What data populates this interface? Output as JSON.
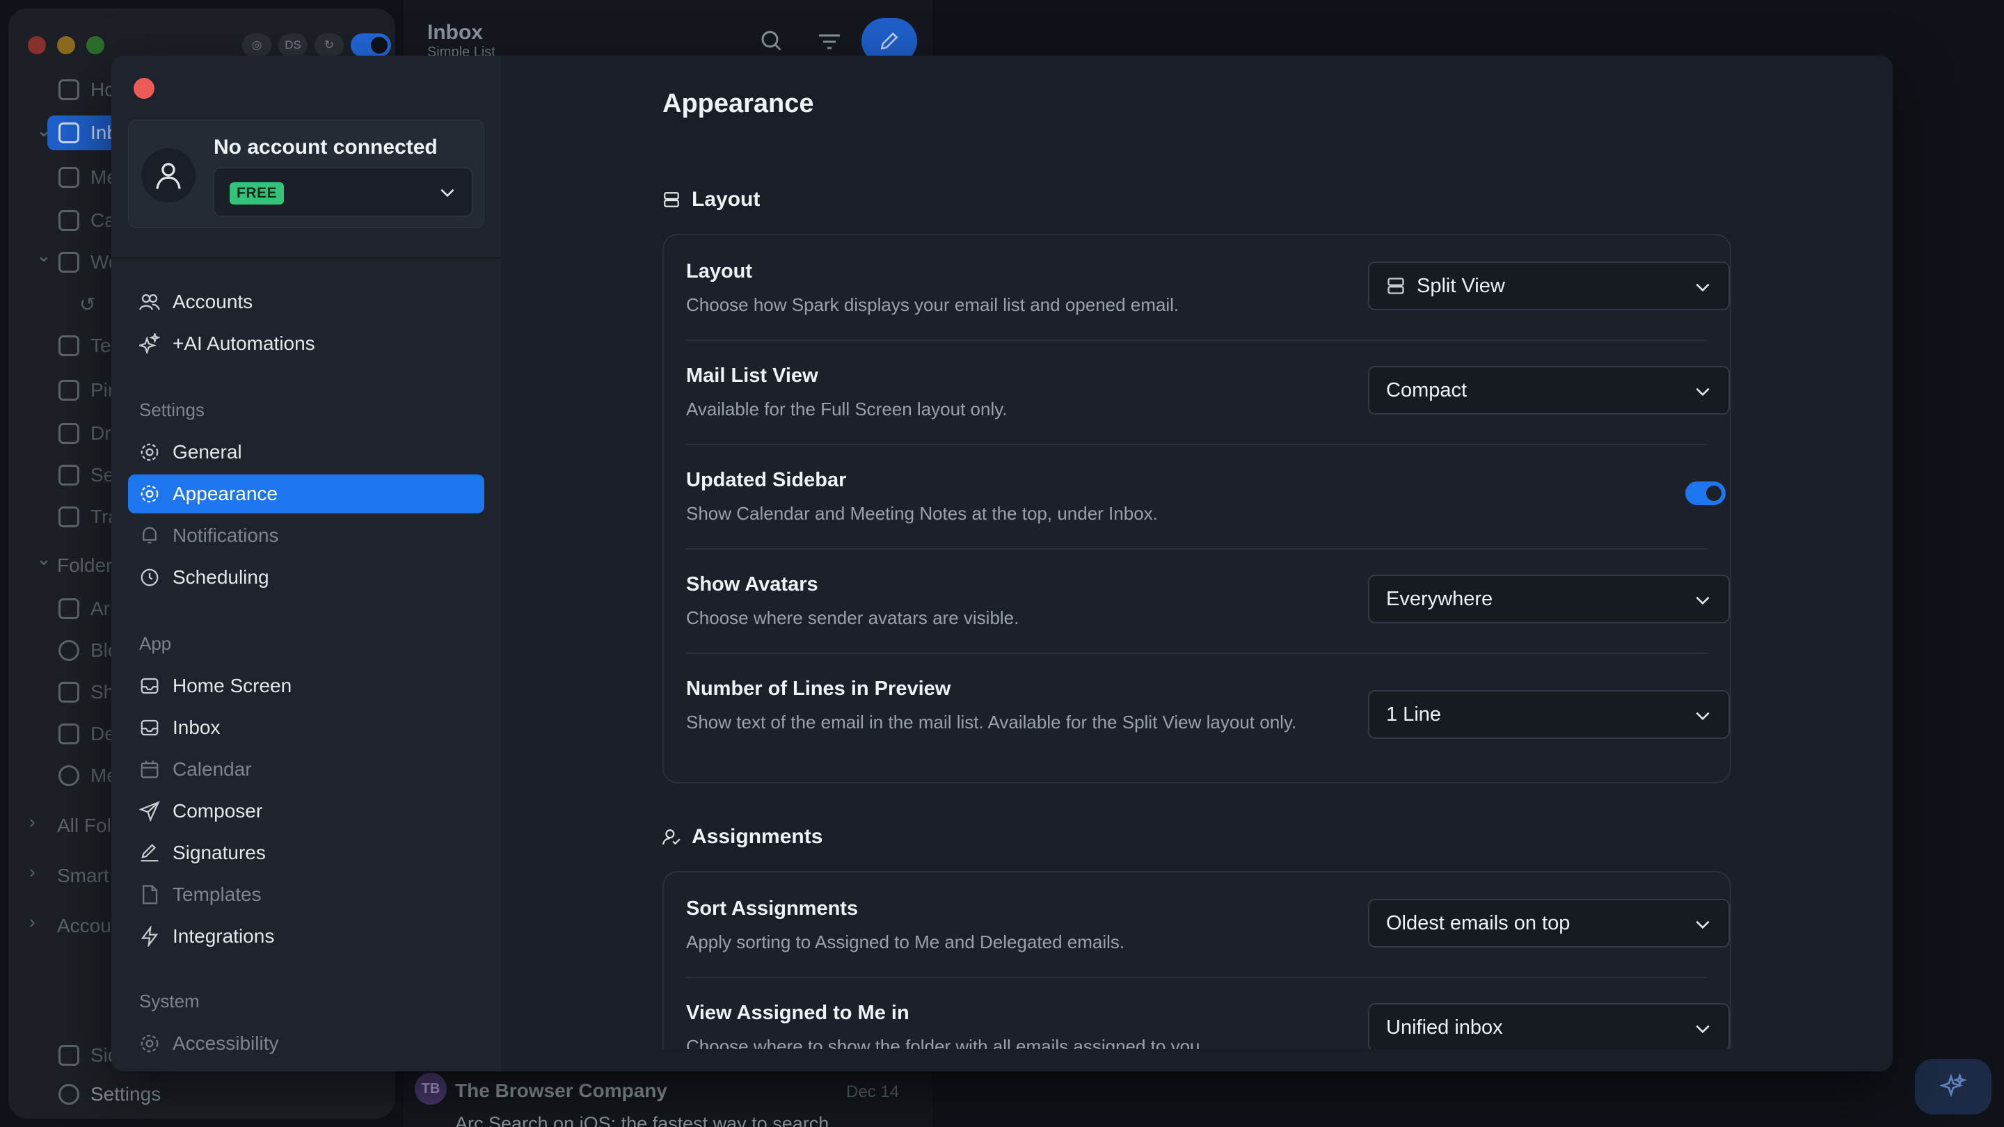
{
  "background_window": {
    "sidebar_icons": [
      "globe-icon",
      "DS",
      "sync-icon"
    ],
    "sidebar_items": [
      "Ho",
      "Inb",
      "Me",
      "Ca",
      "Wo",
      "Te",
      "Pin",
      "Dr",
      "Se",
      "Tra",
      "Folder",
      "Ar",
      "Blo",
      "Sh",
      "De",
      "Me",
      "All Fol",
      "Smart",
      "Accou",
      "Sid",
      "Settings"
    ],
    "main_title": "Inbox",
    "main_subtitle": "Simple List",
    "mail_preview": {
      "avatar": "TB",
      "from": "The Browser Company",
      "date": "Dec 14",
      "subject": "Arc Search on iOS: the fastest way to search"
    }
  },
  "account": {
    "title": "No account connected",
    "plan_badge": "FREE"
  },
  "sidebar": {
    "top_items": [
      {
        "label": "Accounts",
        "icon": "users-icon"
      },
      {
        "label": "+AI Automations",
        "icon": "sparkles-icon"
      }
    ],
    "sections": [
      {
        "heading": "Settings",
        "items": [
          {
            "label": "General",
            "icon": "gear-icon",
            "active": false,
            "dim": false
          },
          {
            "label": "Appearance",
            "icon": "gear-icon",
            "active": true,
            "dim": false
          },
          {
            "label": "Notifications",
            "icon": "bell-icon",
            "active": false,
            "dim": true
          },
          {
            "label": "Scheduling",
            "icon": "clock-icon",
            "active": false,
            "dim": false
          }
        ]
      },
      {
        "heading": "App",
        "items": [
          {
            "label": "Home Screen",
            "icon": "inbox-icon",
            "dim": false
          },
          {
            "label": "Inbox",
            "icon": "inbox-icon",
            "dim": false
          },
          {
            "label": "Calendar",
            "icon": "calendar-icon",
            "dim": true
          },
          {
            "label": "Composer",
            "icon": "send-icon",
            "dim": false
          },
          {
            "label": "Signatures",
            "icon": "pen-icon",
            "dim": false
          },
          {
            "label": "Templates",
            "icon": "document-icon",
            "dim": true
          },
          {
            "label": "Integrations",
            "icon": "bolt-icon",
            "dim": false
          }
        ]
      },
      {
        "heading": "System",
        "items": [
          {
            "label": "Accessibility",
            "icon": "gear-icon",
            "dim": true
          }
        ]
      }
    ]
  },
  "content": {
    "title": "Appearance",
    "layout_section": {
      "heading": "Layout",
      "rows": [
        {
          "title": "Layout",
          "description": "Choose how Spark displays your email list and opened email.",
          "value": "Split View",
          "control": "select"
        },
        {
          "title": "Mail List View",
          "description": "Available for the Full Screen layout only.",
          "value": "Compact",
          "control": "select"
        },
        {
          "title": "Updated Sidebar",
          "description": "Show Calendar and Meeting Notes at the top, under Inbox.",
          "value": "on",
          "control": "toggle"
        },
        {
          "title": "Show Avatars",
          "description": "Choose where sender avatars are visible.",
          "value": "Everywhere",
          "control": "select"
        },
        {
          "title": "Number of Lines in Preview",
          "description": "Show text of the email in the mail list. Available for the Split View layout only.",
          "value": "1 Line",
          "control": "select"
        }
      ]
    },
    "assignments_section": {
      "heading": "Assignments",
      "rows": [
        {
          "title": "Sort Assignments",
          "description": "Apply sorting to Assigned to Me and Delegated emails.",
          "value": "Oldest emails on top",
          "control": "select"
        },
        {
          "title": "View Assigned to Me in",
          "description": "Choose where to show the folder with all emails assigned to you.",
          "value": "Unified inbox",
          "control": "select"
        }
      ]
    }
  },
  "colors": {
    "accent": "#1e76ee",
    "close": "#ec5b57",
    "free_badge": "#33c37a",
    "background": "#0f1319",
    "modal": "#1a1f27"
  }
}
